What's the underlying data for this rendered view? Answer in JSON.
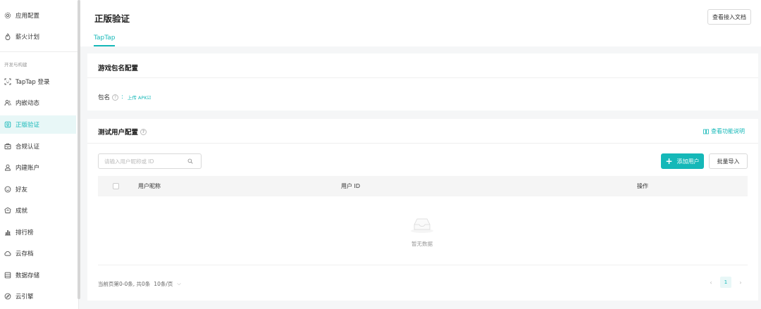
{
  "sidebar": {
    "top_items": [
      {
        "label": "应用配置",
        "icon": "gear-icon"
      },
      {
        "label": "薪火计划",
        "icon": "flame-icon"
      }
    ],
    "section_label": "开发与构建",
    "items": [
      {
        "label": "TapTap 登录",
        "icon": "scan-icon"
      },
      {
        "label": "内嵌动态",
        "icon": "users-icon"
      },
      {
        "label": "正版验证",
        "icon": "badge-icon",
        "active": true
      },
      {
        "label": "合规认证",
        "icon": "id-card-icon"
      },
      {
        "label": "内建账户",
        "icon": "account-icon"
      },
      {
        "label": "好友",
        "icon": "smile-icon"
      },
      {
        "label": "成就",
        "icon": "trophy-icon"
      },
      {
        "label": "排行榜",
        "icon": "bar-chart-icon"
      },
      {
        "label": "云存档",
        "icon": "cloud-icon"
      },
      {
        "label": "数据存储",
        "icon": "database-icon"
      },
      {
        "label": "云引擎",
        "icon": "engine-icon"
      }
    ]
  },
  "header": {
    "title": "正版验证",
    "doc_button": "查看接入文档",
    "tabs": [
      {
        "label": "TapTap"
      }
    ]
  },
  "package_card": {
    "title": "游戏包名配置",
    "package_label": "包名",
    "help": "?",
    "colon": ":",
    "upload_link": "上传 APK☑"
  },
  "test_user_card": {
    "title": "测试用户配置",
    "help": "?",
    "function_link": "查看功能说明",
    "search_placeholder": "请输入用户昵称或 ID",
    "add_button": "添加用户",
    "add_icon": "+",
    "import_button": "批量导入",
    "columns": [
      "用户昵称",
      "用户 ID",
      "操作"
    ],
    "rows": [],
    "empty_text": "暂无数据",
    "page_info": "当前页第0-0条, 共0条",
    "page_size": "10条/页",
    "current_page": "1",
    "prev": "‹",
    "next": "›"
  },
  "colors": {
    "accent": "#15b8b8",
    "active_bg": "#e8f7f7"
  }
}
